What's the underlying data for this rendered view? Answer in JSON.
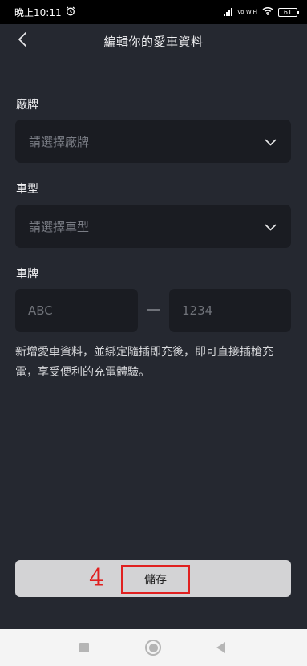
{
  "status_bar": {
    "time": "晚上10:11",
    "alarm_icon": "alarm-clock-icon",
    "network": "Vo WiFi",
    "battery": "61"
  },
  "header": {
    "back_icon": "chevron-left-icon",
    "title": "編輯你的愛車資料"
  },
  "form": {
    "brand": {
      "label": "廠牌",
      "placeholder": "請選擇廠牌",
      "icon": "chevron-down-icon"
    },
    "model": {
      "label": "車型",
      "placeholder": "請選擇車型",
      "icon": "chevron-down-icon"
    },
    "plate": {
      "label": "車牌",
      "prefix_placeholder": "ABC",
      "number_placeholder": "1234",
      "separator": "—"
    },
    "info_text": "新增愛車資料，並綁定隨插即充後，即可直接插槍充電，享受便利的充電體驗。"
  },
  "save_button": {
    "label": "儲存",
    "annotation_number": "4"
  },
  "colors": {
    "background": "#252830",
    "field_background": "#1a1c22",
    "button_background": "#d3d3d5",
    "annotation_red": "#e02020"
  },
  "nav_bar": {
    "items": [
      "square-recents-icon",
      "circle-home-icon",
      "triangle-back-icon"
    ]
  }
}
